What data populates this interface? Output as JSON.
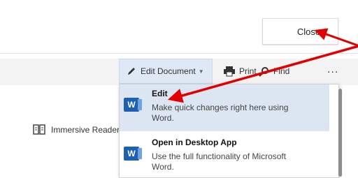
{
  "header": {
    "close_label": "Close"
  },
  "toolbar": {
    "reader_label": "Immersive Reader",
    "edit_label": "Edit Document",
    "print_label": "Print",
    "find_label": "Find",
    "more_label": "..."
  },
  "dropdown": {
    "items": [
      {
        "title": "Edit",
        "description": "Make quick changes right here using Word."
      },
      {
        "title": "Open in Desktop App",
        "description": "Use the full functionality of Microsoft Word."
      }
    ]
  },
  "icons": {
    "reader": "immersive-reader-icon",
    "edit": "pencil-icon",
    "print": "printer-icon",
    "find": "search-icon",
    "word": "word-icon"
  },
  "colors": {
    "annotation_arrow": "#e00000",
    "word_blue": "#1e5fb3",
    "highlight": "#dce6f2"
  }
}
